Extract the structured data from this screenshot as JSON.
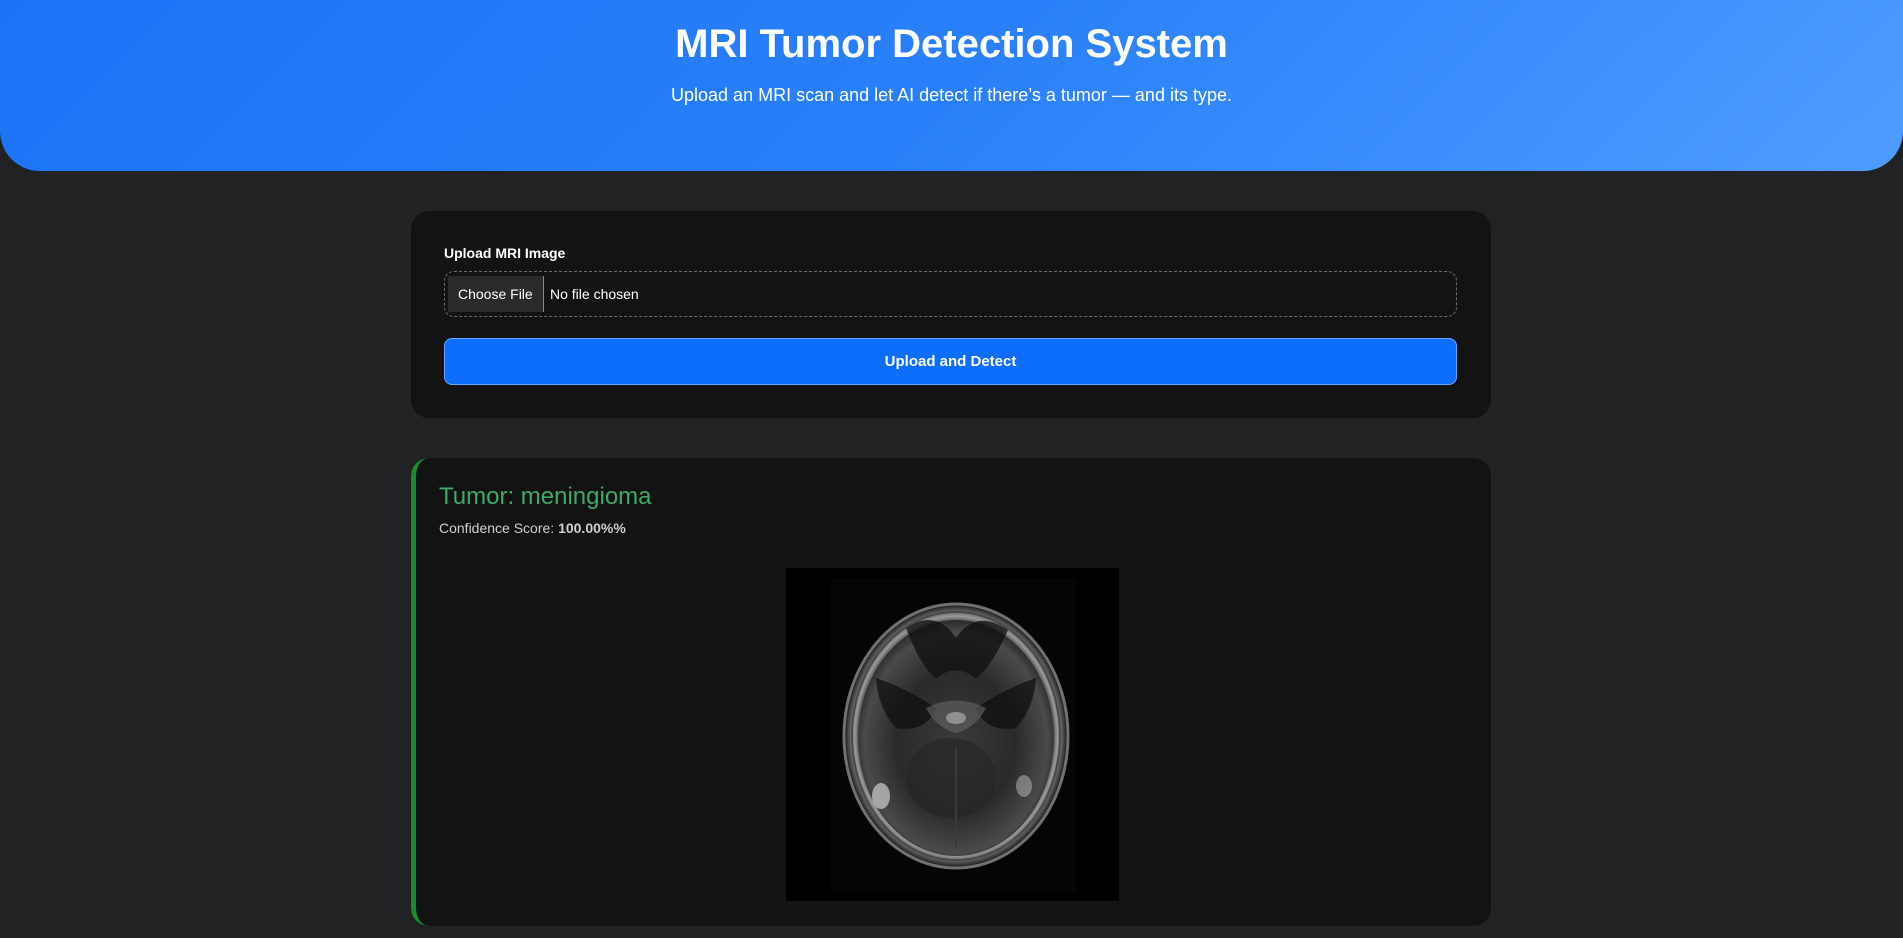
{
  "header": {
    "title": "MRI Tumor Detection System",
    "subtitle": "Upload an MRI scan and let AI detect if there’s a tumor — and its type."
  },
  "upload": {
    "label": "Upload MRI Image",
    "choose_file_label": "Choose File",
    "file_status": "No file chosen",
    "submit_label": "Upload and Detect"
  },
  "result": {
    "title": "Tumor: meningioma",
    "confidence_label": "Confidence Score: ",
    "confidence_value": "100.00%%"
  },
  "colors": {
    "header_gradient_start": "#1a73f5",
    "header_gradient_end": "#4d9cff",
    "page_background": "#212224",
    "card_background": "#131313",
    "primary_button": "#0d6efd",
    "result_accent": "#198c2e",
    "result_title": "#3fa968"
  },
  "icons": {
    "mri_image": "mri-brain-scan-image"
  }
}
